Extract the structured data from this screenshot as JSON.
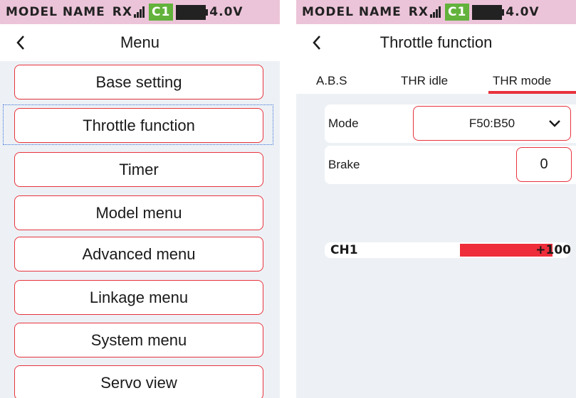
{
  "status_bar": {
    "model_name": "MODEL NAME",
    "rx_label": "RX",
    "channel_badge": "C1",
    "voltage": "4.0V",
    "signal_icon": "signal-bars-icon",
    "battery_icon": "battery-icon"
  },
  "colors": {
    "status_bg": "#ecc4d9",
    "accent_red": "#e8333c",
    "badge_green": "#62b23c",
    "panel_bg": "#edf1f5"
  },
  "menu_screen": {
    "title": "Menu",
    "back_icon": "chevron-left-icon",
    "items": [
      {
        "label": "Base setting"
      },
      {
        "label": "Throttle function",
        "focused": true
      },
      {
        "label": "Timer"
      },
      {
        "label": "Model menu"
      },
      {
        "label": "Advanced menu"
      },
      {
        "label": "Linkage menu"
      },
      {
        "label": "System menu"
      },
      {
        "label": "Servo view"
      }
    ]
  },
  "throttle_screen": {
    "title": "Throttle function",
    "back_icon": "chevron-left-icon",
    "tabs": [
      {
        "label": "A.B.S"
      },
      {
        "label": "THR idle"
      },
      {
        "label": "THR mode",
        "active": true
      }
    ],
    "mode": {
      "label": "Mode",
      "value": "F50:B50",
      "icon": "chevron-down-icon"
    },
    "brake": {
      "label": "Brake",
      "value": "0"
    },
    "channel": {
      "label": "CH1",
      "value": "+100",
      "level_percent": 100
    }
  }
}
